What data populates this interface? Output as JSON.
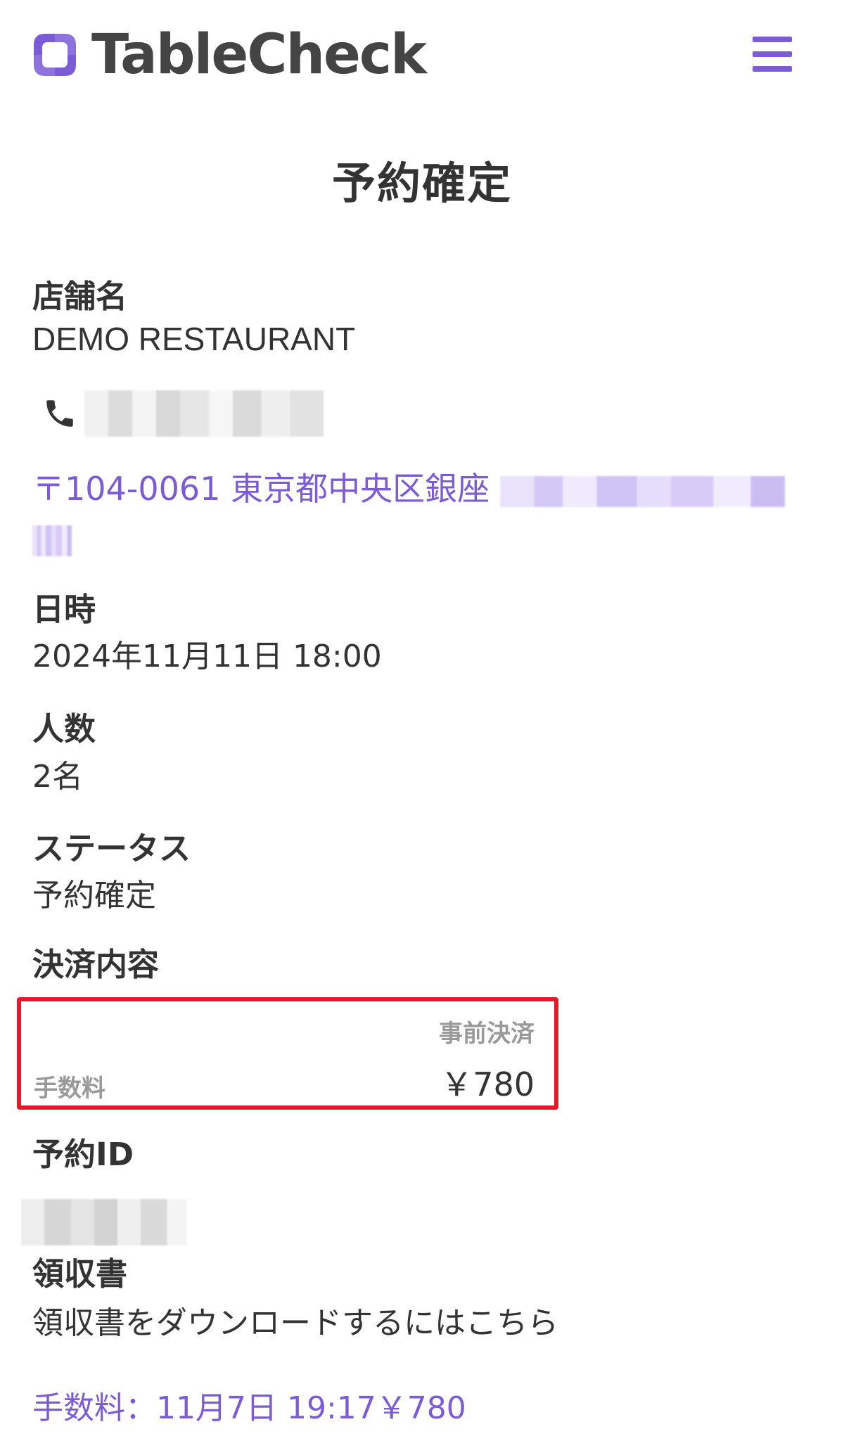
{
  "header": {
    "logo_text": "TableCheck",
    "logo_icon": "tablecheck-logo-icon",
    "menu_icon": "hamburger-menu-icon",
    "accent_color": "#7b5bd6"
  },
  "page": {
    "title": "予約確定"
  },
  "restaurant": {
    "label": "店舗名",
    "name": "DEMO RESTAURANT",
    "phone_icon": "phone-icon",
    "address_visible": "〒104-0061 東京都中央区銀座"
  },
  "datetime": {
    "label": "日時",
    "value": "2024年11月11日 18:00"
  },
  "party": {
    "label": "人数",
    "value": "2名"
  },
  "status": {
    "label": "ステータス",
    "value": "予約確定"
  },
  "payment": {
    "label": "決済内容",
    "type": "事前決済",
    "fee_label": "手数料",
    "fee_amount": "￥780",
    "highlight_color": "#e8182b"
  },
  "reservation_id": {
    "label": "予約ID"
  },
  "receipt": {
    "label": "領収書",
    "description": "領収書をダウンロードするにはこちら",
    "link_text": "手数料：11月7日 19:17￥780"
  }
}
